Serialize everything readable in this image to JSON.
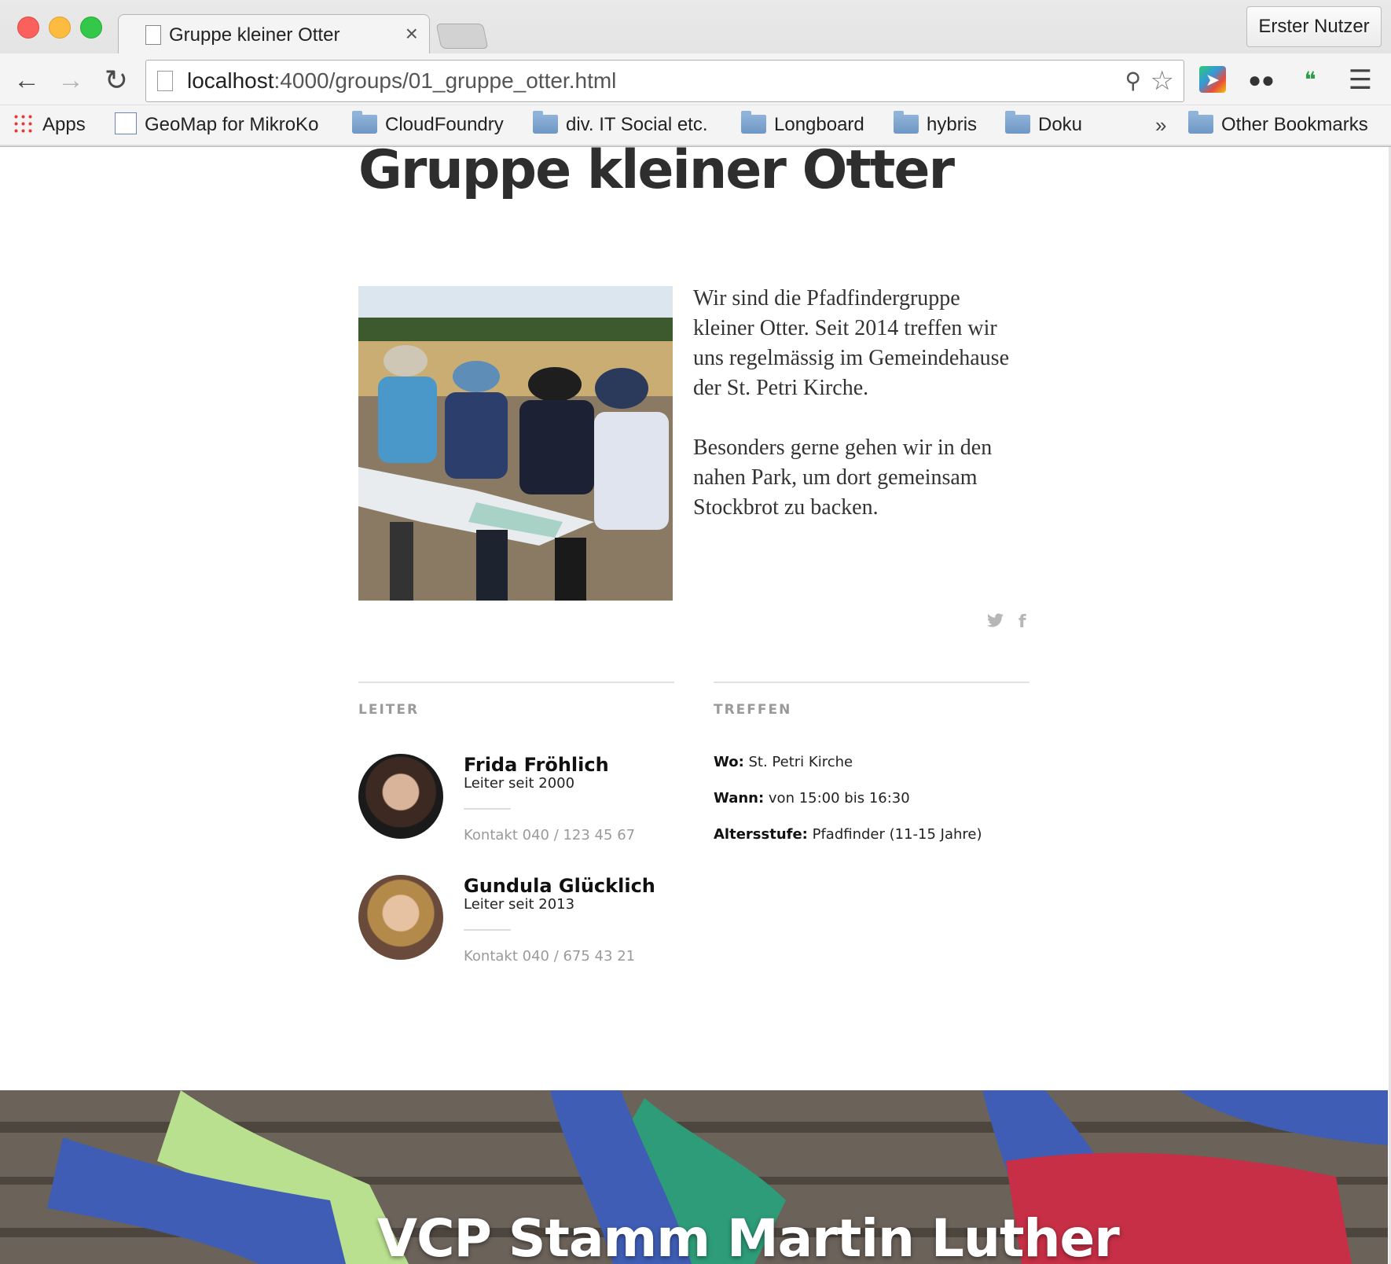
{
  "browser": {
    "tab_title": "Gruppe kleiner Otter",
    "tab_close": "×",
    "profile_button": "Erster Nutzer",
    "url_host": "localhost",
    "url_rest": ":4000/groups/01_gruppe_otter.html",
    "bookmarks": [
      {
        "label": "Apps",
        "icon": "apps-grid-icon"
      },
      {
        "label": "GeoMap for MikroKo",
        "icon": "geomap-icon"
      },
      {
        "label": "CloudFoundry",
        "icon": "folder-icon"
      },
      {
        "label": "div. IT Social etc.",
        "icon": "folder-icon"
      },
      {
        "label": "Longboard",
        "icon": "folder-icon"
      },
      {
        "label": "hybris",
        "icon": "folder-icon"
      },
      {
        "label": "Doku",
        "icon": "folder-icon"
      }
    ],
    "bookmarks_overflow": "»",
    "other_bookmarks": "Other Bookmarks"
  },
  "page": {
    "title": "Gruppe kleiner Otter",
    "intro_paragraphs": [
      "Wir sind die Pfadfindergruppe kleiner Otter. Seit 2014 treffen wir uns regelmässig im Gemeindehause der St. Petri Kirche.",
      "Besonders gerne gehen wir in den nahen Park, um dort gemeinsam Stockbrot zu backen."
    ],
    "share": {
      "twitter": "twitter-icon",
      "facebook": "facebook-icon"
    },
    "leiter_label": "LEITER",
    "treffen_label": "TREFFEN",
    "leaders": [
      {
        "name": "Frida Fröhlich",
        "since": "Leiter seit 2000",
        "contact": "Kontakt 040 / 123 45 67"
      },
      {
        "name": "Gundula Glücklich",
        "since": "Leiter seit 2013",
        "contact": "Kontakt 040 / 675 43 21"
      }
    ],
    "meeting": [
      {
        "key": "Wo:",
        "value": " St. Petri Kirche"
      },
      {
        "key": "Wann:",
        "value": " von 15:00 bis 16:30"
      },
      {
        "key": "Altersstufe:",
        "value": " Pfadfinder (11-15 Jahre)"
      }
    ],
    "footer_title": "VCP Stamm Martin Luther"
  }
}
